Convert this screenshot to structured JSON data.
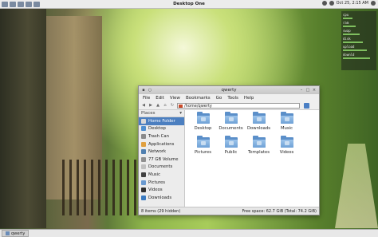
{
  "panel": {
    "title": "Desktop One",
    "clock": "Oct 25,  2:15 AM"
  },
  "conky": {
    "rows": [
      {
        "k": "cpu",
        "v": ""
      },
      {
        "k": "ram",
        "v": ""
      },
      {
        "k": "swap",
        "v": ""
      },
      {
        "k": "disk",
        "v": ""
      },
      {
        "k": "upload",
        "v": ""
      },
      {
        "k": "downld",
        "v": ""
      }
    ]
  },
  "window": {
    "title": "qwerty",
    "menu": [
      "File",
      "Edit",
      "View",
      "Bookmarks",
      "Go",
      "Tools",
      "Help"
    ],
    "address": "/home/qwerty",
    "sidebar": {
      "header": "Places",
      "items": [
        {
          "label": "Home Folder",
          "icon": "home-icon",
          "color": "#d9d9d9",
          "selected": true
        },
        {
          "label": "Desktop",
          "icon": "desktop-icon",
          "color": "#4f8fd0"
        },
        {
          "label": "Trash Can",
          "icon": "trash-icon",
          "color": "#8a8a8a"
        },
        {
          "label": "Applications",
          "icon": "applications-icon",
          "color": "#e0a040"
        },
        {
          "label": "Network",
          "icon": "network-icon",
          "color": "#5080b0"
        },
        {
          "label": "77 GB Volume",
          "icon": "drive-icon",
          "color": "#909090"
        },
        {
          "label": "Documents",
          "icon": "documents-icon",
          "color": "#c0c0c0"
        },
        {
          "label": "Music",
          "icon": "music-icon",
          "color": "#404040"
        },
        {
          "label": "Pictures",
          "icon": "pictures-icon",
          "color": "#6a9ad0"
        },
        {
          "label": "Videos",
          "icon": "videos-icon",
          "color": "#303030"
        },
        {
          "label": "Downloads",
          "icon": "downloads-icon",
          "color": "#3a7ac0"
        }
      ]
    },
    "files": [
      {
        "label": "Desktop",
        "icon": "desktop-folder-icon"
      },
      {
        "label": "Documents",
        "icon": "documents-folder-icon"
      },
      {
        "label": "Downloads",
        "icon": "downloads-folder-icon"
      },
      {
        "label": "Music",
        "icon": "music-folder-icon"
      },
      {
        "label": "Pictures",
        "icon": "pictures-folder-icon"
      },
      {
        "label": "Public",
        "icon": "public-folder-icon"
      },
      {
        "label": "Templates",
        "icon": "templates-folder-icon"
      },
      {
        "label": "Videos",
        "icon": "videos-folder-icon"
      }
    ],
    "status": {
      "left": "8 items (29 hidden)",
      "right": "Free space: 62.7 GiB (Total: 74.2 GiB)"
    }
  },
  "taskbar": {
    "task": "qwerty"
  }
}
